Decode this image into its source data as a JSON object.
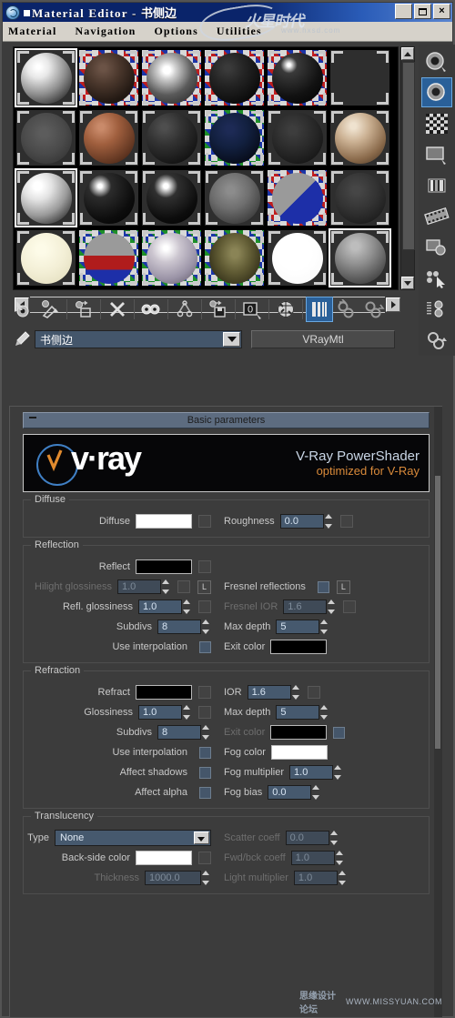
{
  "window": {
    "title_app": "Material Editor",
    "title_sep": "-",
    "title_material": "书侧边",
    "btn_minimize": "_",
    "btn_restore": "restore",
    "btn_close": "×",
    "watermark_cn": "火星时代",
    "watermark_url": "www.hxsd.com"
  },
  "menubar": {
    "items": [
      {
        "label": "Material"
      },
      {
        "label": "Navigation"
      },
      {
        "label": "Options"
      },
      {
        "label": "Utilities"
      }
    ]
  },
  "slots": {
    "rows": [
      [
        {
          "name": "slot-1",
          "kind": "gray-glossy",
          "active": true,
          "checker": false
        },
        {
          "name": "slot-2",
          "kind": "dark-brown",
          "active": false,
          "checker": true
        },
        {
          "name": "slot-3",
          "kind": "white-spots",
          "active": false,
          "checker": true
        },
        {
          "name": "slot-4",
          "kind": "black-rough",
          "active": false,
          "checker": true
        },
        {
          "name": "slot-5",
          "kind": "black-shiny",
          "active": false,
          "checker": true
        },
        {
          "name": "slot-6",
          "kind": "empty",
          "active": false,
          "checker": false
        }
      ],
      [
        {
          "name": "slot-7",
          "kind": "flat-gray",
          "active": false,
          "checker": false
        },
        {
          "name": "slot-8",
          "kind": "copper",
          "active": false,
          "checker": false
        },
        {
          "name": "slot-9",
          "kind": "dark-gray",
          "active": false,
          "checker": false
        },
        {
          "name": "slot-10",
          "kind": "navy-dark",
          "active": false,
          "checker": true
        },
        {
          "name": "slot-11",
          "kind": "charcoal",
          "active": false,
          "checker": false
        },
        {
          "name": "slot-12",
          "kind": "marble-tan",
          "active": false,
          "checker": false
        }
      ],
      [
        {
          "name": "slot-13",
          "kind": "white-chrome",
          "active": true,
          "checker": false
        },
        {
          "name": "slot-14",
          "kind": "black-highlight",
          "active": false,
          "checker": false
        },
        {
          "name": "slot-15",
          "kind": "black-highlight2",
          "active": false,
          "checker": false
        },
        {
          "name": "slot-16",
          "kind": "mid-gray",
          "active": false,
          "checker": false
        },
        {
          "name": "slot-17",
          "kind": "blue-red-quad",
          "active": false,
          "checker": true
        },
        {
          "name": "slot-18",
          "kind": "dark-matte",
          "active": false,
          "checker": false
        }
      ],
      [
        {
          "name": "slot-19",
          "kind": "cream",
          "active": false,
          "checker": false
        },
        {
          "name": "slot-20",
          "kind": "red-blue-blocks",
          "active": false,
          "checker": true
        },
        {
          "name": "slot-21",
          "kind": "noise-pastel",
          "active": false,
          "checker": true
        },
        {
          "name": "slot-22",
          "kind": "olive-stripe",
          "active": false,
          "checker": true
        },
        {
          "name": "slot-23",
          "kind": "pure-white",
          "active": false,
          "checker": false
        },
        {
          "name": "slot-24",
          "kind": "gray-sphere",
          "active": true,
          "checker": false
        }
      ]
    ]
  },
  "toolbar": {
    "items": [
      {
        "name": "get-material-button",
        "icon": "get-material-icon"
      },
      {
        "name": "put-material-to-scene-button",
        "icon": "assign-scene-icon"
      },
      {
        "name": "assign-material-to-selection-button",
        "icon": "assign-selection-icon"
      },
      {
        "name": "reset-map-material-button",
        "icon": "reset-x-icon"
      },
      {
        "name": "make-material-copy-button",
        "icon": "copy-icon"
      },
      {
        "name": "make-unique-button",
        "icon": "make-unique-icon"
      },
      {
        "name": "put-to-library-button",
        "icon": "put-library-icon"
      },
      {
        "name": "material-effects-channel-button",
        "icon": "effects-channel-icon"
      },
      {
        "name": "show-map-in-viewport-button",
        "icon": "show-map-icon"
      },
      {
        "name": "show-end-result-button",
        "icon": "show-end-result-icon",
        "selected": true
      },
      {
        "name": "go-to-parent-button",
        "icon": "go-to-parent-icon"
      },
      {
        "name": "go-forward-to-sibling-button",
        "icon": "go-sibling-icon"
      }
    ]
  },
  "vtools": {
    "items": [
      {
        "name": "sample-type-button",
        "icon": "sample-sphere-icon"
      },
      {
        "name": "backlight-button",
        "icon": "backlight-icon",
        "selected": true
      },
      {
        "name": "background-button",
        "icon": "checker-background-icon"
      },
      {
        "name": "sample-uv-tiling-button",
        "icon": "uv-tiling-icon"
      },
      {
        "name": "video-color-check-button",
        "icon": "video-color-check-icon"
      },
      {
        "name": "make-preview-button",
        "icon": "film-strip-icon"
      },
      {
        "name": "options-button",
        "icon": "options-icon"
      },
      {
        "name": "select-by-material-button",
        "icon": "select-by-material-icon"
      },
      {
        "name": "material-map-navigator-button",
        "icon": "map-navigator-icon"
      },
      {
        "name": "go-forward-button",
        "icon": "go-forward-icon"
      }
    ]
  },
  "name_row": {
    "pick_icon": "eyedropper-icon",
    "material_name": "书侧边",
    "material_type": "VRayMtl"
  },
  "rollout": {
    "collapse_symbol": "-",
    "title": "Basic parameters"
  },
  "banner": {
    "logo_text": "v·ray",
    "line1": "V-Ray PowerShader",
    "line2": "optimized for V-Ray"
  },
  "groups": {
    "diffuse": {
      "title": "Diffuse",
      "rows": [
        {
          "left": {
            "label": "Diffuse",
            "type": "color",
            "value": "#ffffff",
            "map": true
          },
          "right": {
            "label": "Roughness",
            "type": "spin",
            "value": "0.0",
            "map": true,
            "dim": false
          }
        }
      ]
    },
    "reflection": {
      "title": "Reflection",
      "rows": [
        {
          "left": {
            "label": "Reflect",
            "type": "color",
            "value": "#000000",
            "map": true
          },
          "right": null
        },
        {
          "left": {
            "label": "Hilight glossiness",
            "type": "spin",
            "value": "1.0",
            "map": true,
            "dim": true,
            "lbtn": "L"
          },
          "right": {
            "label": "Fresnel reflections",
            "type": "check",
            "checked": false,
            "lbtn": "L"
          }
        },
        {
          "left": {
            "label": "Refl. glossiness",
            "type": "spin",
            "value": "1.0",
            "map": true,
            "dim": false
          },
          "right": {
            "label": "Fresnel IOR",
            "type": "spin",
            "value": "1.6",
            "map": true,
            "dim": true
          }
        },
        {
          "left": {
            "label": "Subdivs",
            "type": "spin",
            "value": "8",
            "map": false,
            "dim": false
          },
          "right": {
            "label": "Max depth",
            "type": "spin",
            "value": "5",
            "map": false,
            "dim": false
          }
        },
        {
          "left": {
            "label": "Use interpolation",
            "type": "check",
            "checked": false
          },
          "right": {
            "label": "Exit color",
            "type": "color",
            "value": "#000000",
            "map": false
          }
        }
      ]
    },
    "refraction": {
      "title": "Refraction",
      "rows": [
        {
          "left": {
            "label": "Refract",
            "type": "color",
            "value": "#000000",
            "map": true
          },
          "right": {
            "label": "IOR",
            "type": "spin",
            "value": "1.6",
            "map": true,
            "dim": false
          }
        },
        {
          "left": {
            "label": "Glossiness",
            "type": "spin",
            "value": "1.0",
            "map": true,
            "dim": false
          },
          "right": {
            "label": "Max depth",
            "type": "spin",
            "value": "5",
            "map": false,
            "dim": false
          }
        },
        {
          "left": {
            "label": "Subdivs",
            "type": "spin",
            "value": "8",
            "map": false,
            "dim": false
          },
          "right": {
            "label": "Exit color",
            "type": "color",
            "value": "#000000",
            "map": false,
            "dim": true,
            "check": true
          }
        },
        {
          "left": {
            "label": "Use interpolation",
            "type": "check",
            "checked": false
          },
          "right": {
            "label": "Fog color",
            "type": "color",
            "value": "#ffffff",
            "map": false
          }
        },
        {
          "left": {
            "label": "Affect shadows",
            "type": "check",
            "checked": false
          },
          "right": {
            "label": "Fog multiplier",
            "type": "spin",
            "value": "1.0",
            "map": false,
            "dim": false
          }
        },
        {
          "left": {
            "label": "Affect alpha",
            "type": "check",
            "checked": false
          },
          "right": {
            "label": "Fog bias",
            "type": "spin",
            "value": "0.0",
            "map": false,
            "dim": false
          }
        }
      ]
    },
    "translucency": {
      "title": "Translucency",
      "rows": [
        {
          "left": {
            "label": "Type",
            "type": "combo",
            "value": "None"
          },
          "right": {
            "label": "Scatter coeff",
            "type": "spin",
            "value": "0.0",
            "map": false,
            "dim": true
          }
        },
        {
          "left": {
            "label": "Back-side color",
            "type": "color",
            "value": "#ffffff",
            "map": true
          },
          "right": {
            "label": "Fwd/bck coeff",
            "type": "spin",
            "value": "1.0",
            "map": false,
            "dim": true
          }
        },
        {
          "left": {
            "label": "Thickness",
            "type": "spin",
            "value": "1000.0",
            "map": false,
            "dim": true
          },
          "right": {
            "label": "Light multiplier",
            "type": "spin",
            "value": "1.0",
            "map": false,
            "dim": true
          }
        }
      ]
    }
  },
  "footer": {
    "watermark_cn": "思缘设计论坛",
    "watermark_url": "WWW.MISSYUAN.COM"
  }
}
